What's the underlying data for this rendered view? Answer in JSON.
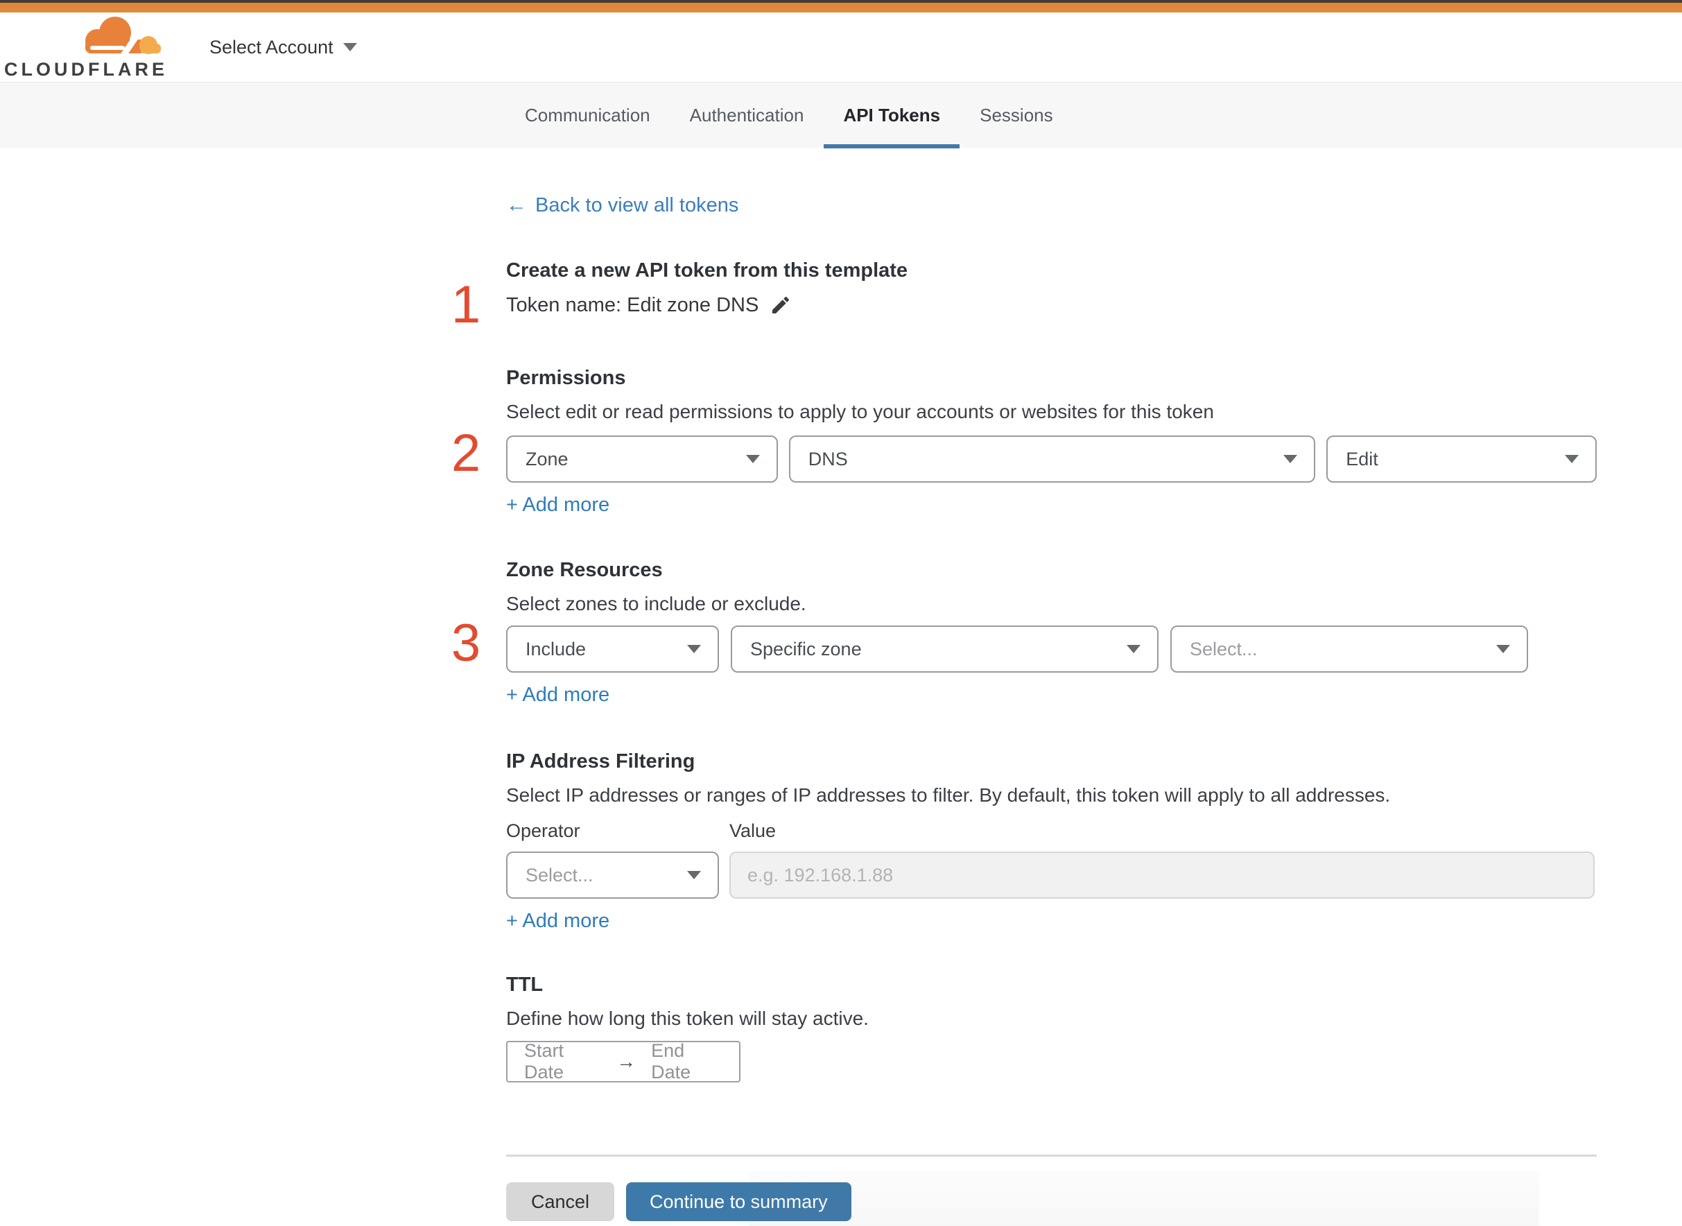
{
  "header": {
    "brand": "CLOUDFLARE",
    "account_selector_label": "Select Account"
  },
  "tabs": [
    {
      "label": "Communication"
    },
    {
      "label": "Authentication"
    },
    {
      "label": "API Tokens"
    },
    {
      "label": "Sessions"
    }
  ],
  "active_tab": "API Tokens",
  "back_link": {
    "arrow": "←",
    "label": "Back to view all tokens"
  },
  "annotations": {
    "step1": "1",
    "step2": "2",
    "step3": "3"
  },
  "template_section": {
    "heading": "Create a new API token from this template",
    "token_name_line": "Token name: Edit zone DNS"
  },
  "permissions": {
    "heading": "Permissions",
    "description": "Select edit or read permissions to apply to your accounts or websites for this token",
    "dropdowns": [
      {
        "value": "Zone"
      },
      {
        "value": "DNS"
      },
      {
        "value": "Edit"
      }
    ],
    "add_more": "+ Add more"
  },
  "zone_resources": {
    "heading": "Zone Resources",
    "description": "Select zones to include or exclude.",
    "dropdowns": [
      {
        "value": "Include"
      },
      {
        "value": "Specific zone"
      },
      {
        "value": "Select..."
      }
    ],
    "add_more": "+ Add more"
  },
  "ip_filtering": {
    "heading": "IP Address Filtering",
    "description": "Select IP addresses or ranges of IP addresses to filter. By default, this token will apply to all addresses.",
    "operator_label": "Operator",
    "value_label": "Value",
    "operator_value": "Select...",
    "value_placeholder": "e.g. 192.168.1.88",
    "add_more": "+ Add more"
  },
  "ttl": {
    "heading": "TTL",
    "description": "Define how long this token will stay active.",
    "start_label": "Start Date",
    "arrow": "→",
    "end_label": "End Date"
  },
  "footer": {
    "cancel_label": "Cancel",
    "continue_label": "Continue to summary"
  },
  "colors": {
    "accent_orange": "#e0883d",
    "annotation_red": "#e34b2e",
    "link_blue": "#3b7dbe",
    "add_more_blue": "#2f7bc0",
    "button_blue": "#3e7aa9",
    "tab_underline_blue": "#4478a9"
  }
}
